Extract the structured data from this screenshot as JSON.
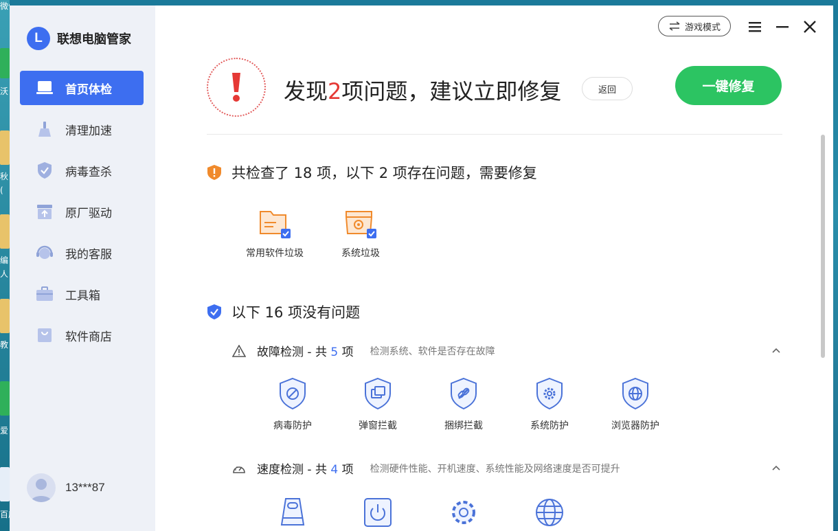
{
  "desktop": {
    "labels": [
      "微信",
      "沃",
      "秋",
      "(",
      "编",
      "人",
      "教",
      "爱",
      "百度"
    ]
  },
  "sidebar": {
    "brand_logo_letter": "L",
    "brand_name": "联想电脑管家",
    "items": [
      {
        "label": "首页体检",
        "icon": "laptop-icon",
        "active": true
      },
      {
        "label": "清理加速",
        "icon": "broom-icon",
        "active": false
      },
      {
        "label": "病毒查杀",
        "icon": "shield-check-icon",
        "active": false
      },
      {
        "label": "原厂驱动",
        "icon": "driver-upload-icon",
        "active": false
      },
      {
        "label": "我的客服",
        "icon": "headset-icon",
        "active": false
      },
      {
        "label": "工具箱",
        "icon": "toolbox-icon",
        "active": false
      },
      {
        "label": "软件商店",
        "icon": "store-bag-icon",
        "active": false
      }
    ],
    "user_name": "13***87"
  },
  "topbar": {
    "game_mode_label": "游戏模式"
  },
  "header": {
    "headline_prefix": "发现",
    "headline_count": "2",
    "headline_suffix": "项问题，建议立即修复",
    "back_label": "返回",
    "fix_label": "一键修复"
  },
  "issues_section": {
    "title": "共检查了 18 项，以下 2 项存在问题，需要修复",
    "items": [
      {
        "label": "常用软件垃圾",
        "icon": "folder-checked-icon"
      },
      {
        "label": "系统垃圾",
        "icon": "gear-box-checked-icon"
      }
    ]
  },
  "ok_section": {
    "title": "以下 16 项没有问题",
    "groups": [
      {
        "name_prefix": "故障检测 - 共 ",
        "count": "5",
        "name_suffix": " 项",
        "desc": "检测系统、软件是否存在故障",
        "items": [
          "病毒防护",
          "弹窗拦截",
          "捆绑拦截",
          "系统防护",
          "浏览器防护"
        ]
      },
      {
        "name_prefix": "速度检测 - 共 ",
        "count": "4",
        "name_suffix": " 项",
        "desc": "检测硬件性能、开机速度、系统性能及网络速度是否可提升",
        "items": [
          "",
          "",
          "",
          ""
        ]
      }
    ]
  },
  "colors": {
    "accent": "#3d6ef0",
    "danger": "#e53935",
    "success": "#2cc462",
    "warning": "#f08a2c"
  }
}
